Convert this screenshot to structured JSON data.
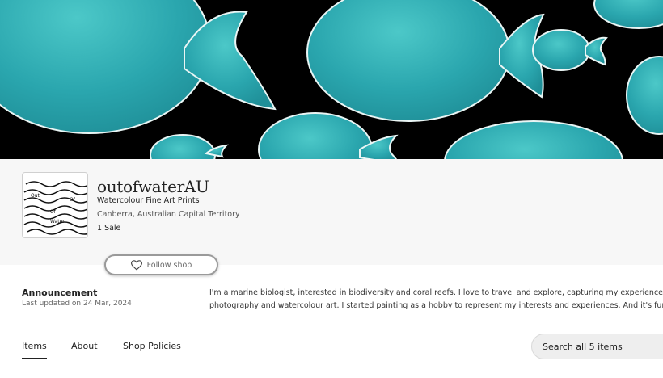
{
  "banner": {
    "image": "watercolour-teal-fish-on-black",
    "colors": {
      "background": "#000000",
      "fish": "#2aa6ae",
      "fish_highlight": "#3ec0c4",
      "fish_edge": "#e9f5f4"
    }
  },
  "shop": {
    "name": "outofwaterAU",
    "tagline": "Watercolour Fine Art Prints",
    "location": "Canberra, Australian Capital Territory",
    "sales": "1 Sale",
    "logo": {
      "words": [
        "Out",
        "Of",
        "Water"
      ]
    }
  },
  "follow": {
    "label": "Follow shop",
    "icon": "heart-icon"
  },
  "announcement": {
    "title": "Announcement",
    "date": "Last updated on 24 Mar, 2024",
    "line1": "I'm a marine biologist, interested in biodiversity and coral reefs. I love to travel and explore, capturing my experiences throug",
    "line2": "photography and watercolour art. I started painting as a hobby to represent my interests and experiences. And it's fun!"
  },
  "tabs": [
    {
      "label": "Items",
      "active": true
    },
    {
      "label": "About",
      "active": false
    },
    {
      "label": "Shop Policies",
      "active": false
    }
  ],
  "search": {
    "placeholder": "Search all 5 items"
  }
}
